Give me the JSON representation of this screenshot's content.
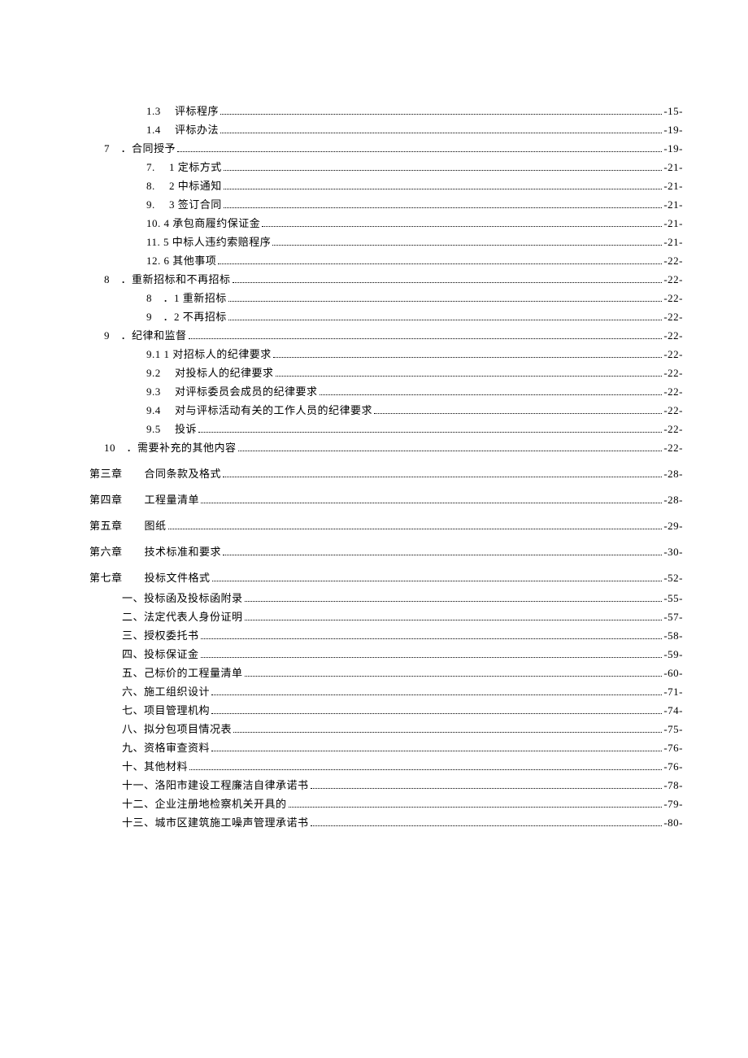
{
  "lines": [
    {
      "indent": 3,
      "label": "1.3　 评标程序 ",
      "page": "-15-"
    },
    {
      "indent": 3,
      "label": "1.4　 评标办法 ",
      "page": "-19-"
    },
    {
      "indent": 1,
      "label": "7　．合同授予",
      "page": "-19-"
    },
    {
      "indent": 3,
      "label": "7.　 1 定标方式 ",
      "page": "-21-"
    },
    {
      "indent": 3,
      "label": "8.　 2 中标通知 ",
      "page": "-21-"
    },
    {
      "indent": 3,
      "label": "9.　 3 签订合同 ",
      "page": "-21-"
    },
    {
      "indent": 3,
      "label": "10. 4 承包商履约保证金 ",
      "page": "-21-"
    },
    {
      "indent": 3,
      "label": "11. 5 中标人违约索赔程序 ",
      "page": "-21-"
    },
    {
      "indent": 3,
      "label": "12. 6 其他事项 ",
      "page": "-22-"
    },
    {
      "indent": 1,
      "label": "8　．重新招标和不再招标 ",
      "page": "-22-"
    },
    {
      "indent": 3,
      "label": "8　．1 重新招标",
      "page": "-22-"
    },
    {
      "indent": 3,
      "label": "9　．2 不再招标",
      "page": "-22-"
    },
    {
      "indent": 1,
      "label": "9　．纪律和监督 ",
      "page": "-22-"
    },
    {
      "indent": 3,
      "label": "9.1 1 对招标人的纪律要求 ",
      "page": "-22-"
    },
    {
      "indent": 3,
      "label": "9.2　 对投标人的纪律要求 ",
      "page": "-22-"
    },
    {
      "indent": 3,
      "label": "9.3　 对评标委员会成员的纪律要求 ",
      "page": "-22-"
    },
    {
      "indent": 3,
      "label": "9.4　 对与评标活动有关的工作人员的纪律要求 ",
      "page": "-22-"
    },
    {
      "indent": 3,
      "label": "9.5　 投诉 ",
      "page": "-22-"
    },
    {
      "indent": 1,
      "label": "10　．需要补充的其他内容",
      "page": "-22-"
    }
  ],
  "chapters": [
    {
      "label": "第三章　　合同条款及格式",
      "page": "-28-"
    },
    {
      "label": "第四章　　工程量清单",
      "page": "-28-"
    },
    {
      "label": "第五章　　图纸",
      "page": "-29-"
    },
    {
      "label": "第六章　　技术标准和要求",
      "page": "-30-"
    },
    {
      "label": "第七章　　投标文件格式",
      "page": "-52-"
    }
  ],
  "subitems": [
    {
      "label": "一、投标函及投标函附录 ",
      "page": "-55-"
    },
    {
      "label": "二、法定代表人身份证明 ",
      "page": "-57-"
    },
    {
      "label": "三、授权委托书 ",
      "page": "-58-"
    },
    {
      "label": "四、投标保证金 ",
      "page": "-59-"
    },
    {
      "label": "五、己标价的工程量清单 ",
      "page": "-60-"
    },
    {
      "label": "六、施工组织设计 ",
      "page": "-71-"
    },
    {
      "label": "七、项目管理机构 ",
      "page": "-74-"
    },
    {
      "label": "八、拟分包项目情况表 ",
      "page": "-75-"
    },
    {
      "label": "九、资格审查资料 ",
      "page": "-76-"
    },
    {
      "label": "十、其他材料 ",
      "page": "-76-"
    },
    {
      "label": "十一、洛阳市建设工程廉洁自律承诺书 ",
      "page": "-78-"
    },
    {
      "label": "十二、企业注册地检察机关开具的 ",
      "page": "-79-"
    },
    {
      "label": "十三、城市区建筑施工噪声管理承诺书 ",
      "page": "-80-"
    }
  ]
}
